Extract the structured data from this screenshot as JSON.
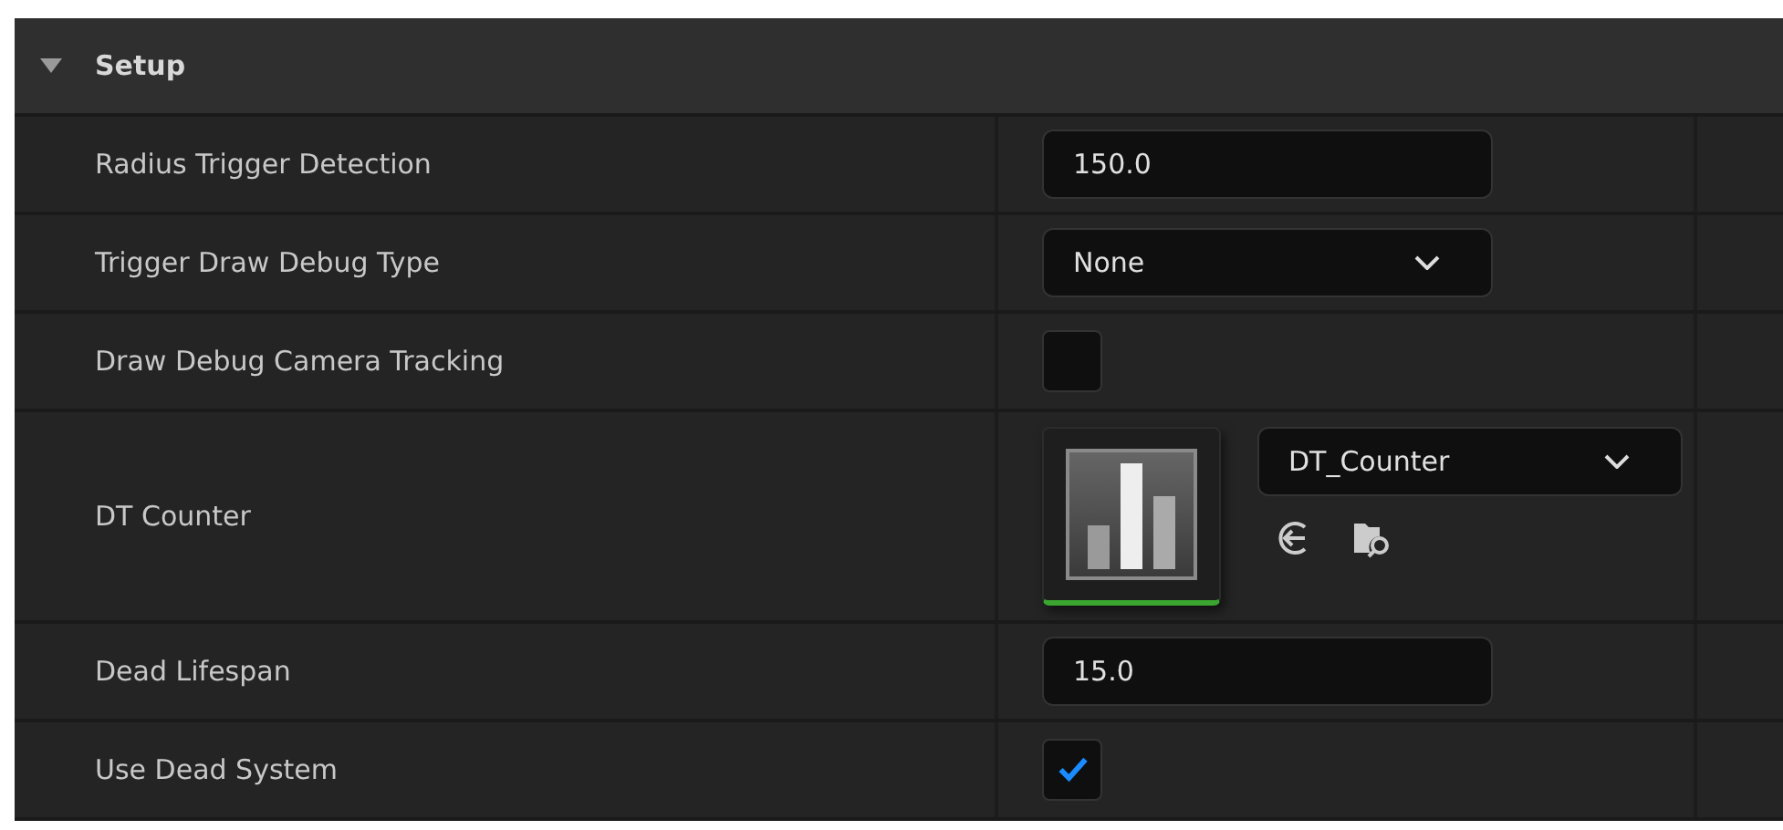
{
  "section": {
    "title": "Setup",
    "expanded": true
  },
  "properties": [
    {
      "kind": "number",
      "label": "Radius Trigger Detection",
      "value": "150.0"
    },
    {
      "kind": "enum",
      "label": "Trigger Draw Debug Type",
      "value": "None"
    },
    {
      "kind": "checkbox",
      "label": "Draw Debug Camera Tracking",
      "checked": false
    },
    {
      "kind": "asset",
      "label": "DT Counter",
      "value": "DT_Counter"
    },
    {
      "kind": "number",
      "label": "Dead Lifespan",
      "value": "15.0"
    },
    {
      "kind": "checkbox",
      "label": "Use Dead System",
      "checked": true
    }
  ]
}
